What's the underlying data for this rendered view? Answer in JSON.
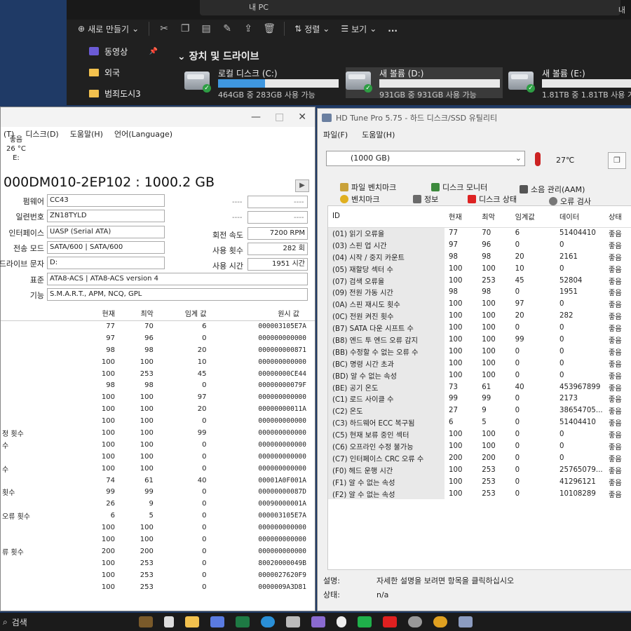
{
  "explorer": {
    "address": "내 PC",
    "corner": "내",
    "toolbar": {
      "new_label": "새로 만들기",
      "sort_label": "정렬",
      "view_label": "보기",
      "more_label": "..."
    },
    "sidebar": [
      {
        "label": "동영상",
        "icon": "video-icon",
        "pinned": true
      },
      {
        "label": "외국",
        "icon": "folder-icon",
        "pinned": false
      },
      {
        "label": "범죄도시3",
        "icon": "folder-icon",
        "pinned": false
      }
    ],
    "section_title": "장치 및 드라이브",
    "drives": [
      {
        "name": "로컬 디스크 (C:)",
        "free": "464GB 중 283GB 사용 가능",
        "used_fraction": 0.39
      },
      {
        "name": "새 볼륨 (D:)",
        "free": "931GB 중 931GB 사용 가능",
        "used_fraction": 0.0
      },
      {
        "name": "새 볼륨 (E:)",
        "free": "1.81TB 중 1.81TB 사용 가능",
        "used_fraction": 0.0
      }
    ]
  },
  "cdi": {
    "menu": [
      "(T)",
      "디스크(D)",
      "도움말(H)",
      "언어(Language)"
    ],
    "health": {
      "status": "좋음",
      "temp": "26 °C",
      "drive": "E:"
    },
    "model": "000DM010-2EP102 : 1000.2 GB",
    "info": {
      "firmware_label": "펌웨어",
      "firmware": "CC43",
      "serial_label": "일련번호",
      "serial": "ZN18TYLD",
      "interface_label": "인터페이스",
      "interface": "UASP (Serial ATA)",
      "transfer_label": "전송 모드",
      "transfer": "SATA/600 | SATA/600",
      "letter_label": "드라이브 문자",
      "letter": "D:",
      "standard_label": "표준",
      "standard": "ATA8-ACS | ATA8-ACS version 4",
      "features_label": "기능",
      "features": "S.M.A.R.T., APM, NCQ, GPL",
      "dash": "----",
      "rpm_label": "회전 속도",
      "rpm": "7200 RPM",
      "count_label": "사용 횟수",
      "count": "282 회",
      "hours_label": "사용 시간",
      "hours": "1951 시간"
    },
    "table_headers": [
      "",
      "현재",
      "최악",
      "임계 값",
      "원시 값"
    ],
    "rows": [
      [
        "",
        "77",
        "70",
        "6",
        "000003105E7A"
      ],
      [
        "",
        "97",
        "96",
        "0",
        "000000000000"
      ],
      [
        "",
        "98",
        "98",
        "20",
        "000000000871"
      ],
      [
        "",
        "100",
        "100",
        "10",
        "000000000000"
      ],
      [
        "",
        "100",
        "253",
        "45",
        "00000000CE44"
      ],
      [
        "",
        "98",
        "98",
        "0",
        "00000000079F"
      ],
      [
        "",
        "100",
        "100",
        "97",
        "000000000000"
      ],
      [
        "",
        "100",
        "100",
        "20",
        "00000000011A"
      ],
      [
        "",
        "100",
        "100",
        "0",
        "000000000000"
      ],
      [
        "정 횟수",
        "100",
        "100",
        "99",
        "000000000000"
      ],
      [
        "수",
        "100",
        "100",
        "0",
        "000000000000"
      ],
      [
        "",
        "100",
        "100",
        "0",
        "000000000000"
      ],
      [
        "수",
        "100",
        "100",
        "0",
        "000000000000"
      ],
      [
        "",
        "74",
        "61",
        "40",
        "00001A0F001A"
      ],
      [
        "횟수",
        "99",
        "99",
        "0",
        "00000000087D"
      ],
      [
        "",
        "26",
        "9",
        "0",
        "00090000001A"
      ],
      [
        "오류 횟수",
        "6",
        "5",
        "0",
        "000003105E7A"
      ],
      [
        "",
        "100",
        "100",
        "0",
        "000000000000"
      ],
      [
        "",
        "100",
        "100",
        "0",
        "000000000000"
      ],
      [
        "류 횟수",
        "200",
        "200",
        "0",
        "000000000000"
      ],
      [
        "",
        "100",
        "253",
        "0",
        "80020000049B"
      ],
      [
        "",
        "100",
        "253",
        "0",
        "0000027620F9"
      ],
      [
        "",
        "100",
        "253",
        "0",
        "0000009A3D81"
      ]
    ]
  },
  "hdt": {
    "title": "HD Tune Pro 5.75 - 하드 디스크/SSD 유틸리티",
    "menu": [
      "파일(F)",
      "도움말(H)"
    ],
    "drive": "(1000 GB)",
    "temp": "27℃",
    "tabs_row1": [
      "파일 벤치마크",
      "디스크 모니터",
      "소음 관리(AAM)"
    ],
    "tabs_row2": [
      "벤치마크",
      "정보",
      "디스크 상태",
      "오류 검사"
    ],
    "headers": [
      "ID",
      "현재",
      "최악",
      "임계값",
      "데이터",
      "상태"
    ],
    "rows": [
      [
        "(01) 읽기 오류율",
        "77",
        "70",
        "6",
        "51404410",
        "좋음"
      ],
      [
        "(03) 스핀 업 시간",
        "97",
        "96",
        "0",
        "0",
        "좋음"
      ],
      [
        "(04) 시작 / 중지 카운트",
        "98",
        "98",
        "20",
        "2161",
        "좋음"
      ],
      [
        "(05) 재할당 섹터 수",
        "100",
        "100",
        "10",
        "0",
        "좋음"
      ],
      [
        "(07) 검색 오류율",
        "100",
        "253",
        "45",
        "52804",
        "좋음"
      ],
      [
        "(09) 전원 가동 시간",
        "98",
        "98",
        "0",
        "1951",
        "좋음"
      ],
      [
        "(0A) 스핀 재시도 횟수",
        "100",
        "100",
        "97",
        "0",
        "좋음"
      ],
      [
        "(0C) 전원 켜진 횟수",
        "100",
        "100",
        "20",
        "282",
        "좋음"
      ],
      [
        "(B7) SATA 다운 시프트 수",
        "100",
        "100",
        "0",
        "0",
        "좋음"
      ],
      [
        "(B8) 엔드 투 엔드 오류 감지",
        "100",
        "100",
        "99",
        "0",
        "좋음"
      ],
      [
        "(BB) 수정할 수 없는 오류 수",
        "100",
        "100",
        "0",
        "0",
        "좋음"
      ],
      [
        "(BC) 명령 시간 초과",
        "100",
        "100",
        "0",
        "0",
        "좋음"
      ],
      [
        "(BD) 알 수 없는 속성",
        "100",
        "100",
        "0",
        "0",
        "좋음"
      ],
      [
        "(BE) 공기 온도",
        "73",
        "61",
        "40",
        "453967899",
        "좋음"
      ],
      [
        "(C1) 로드 사이클 수",
        "99",
        "99",
        "0",
        "2173",
        "좋음"
      ],
      [
        "(C2) 온도",
        "27",
        "9",
        "0",
        "38654705...",
        "좋음"
      ],
      [
        "(C3) 하드웨어 ECC 복구됨",
        "6",
        "5",
        "0",
        "51404410",
        "좋음"
      ],
      [
        "(C5) 현재 보류 중인 섹터",
        "100",
        "100",
        "0",
        "0",
        "좋음"
      ],
      [
        "(C6) 오프라인 수정 불가능",
        "100",
        "100",
        "0",
        "0",
        "좋음"
      ],
      [
        "(C7) 인터페이스 CRC 오류 수",
        "200",
        "200",
        "0",
        "0",
        "좋음"
      ],
      [
        "(F0) 헤드 운행 시간",
        "100",
        "253",
        "0",
        "25765079...",
        "좋음"
      ],
      [
        "(F1) 알 수 없는 속성",
        "100",
        "253",
        "0",
        "41296121",
        "좋음"
      ],
      [
        "(F2) 알 수 없는 속성",
        "100",
        "253",
        "0",
        "10108289",
        "좋음"
      ]
    ],
    "desc_label": "설명:",
    "desc_text": "자세한 설명을 보려면 항목을 클릭하십시오",
    "status_label": "상태:",
    "status_text": "n/a"
  },
  "taskbar": {
    "search_label": "검색",
    "apps": [
      "gallery-icon",
      "folder-icon",
      "copilot-icon",
      "excel-icon",
      "edge-icon",
      "store-icon",
      "photos-icon",
      "chat-icon",
      "naver-icon",
      "youtube-icon",
      "settings-icon",
      "chrome-icon",
      "util-icon"
    ]
  }
}
